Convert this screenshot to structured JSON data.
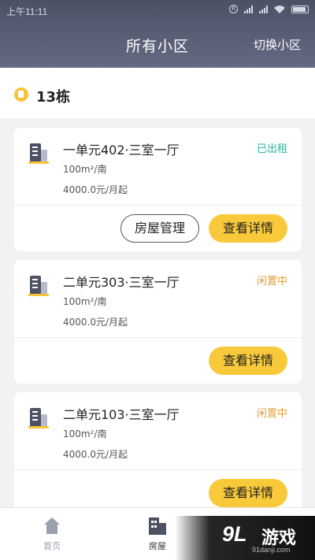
{
  "status_bar": {
    "time": "上午11:11",
    "icons": [
      "r-circle-icon",
      "signal-icon",
      "signal-icon",
      "wifi-icon",
      "battery-icon"
    ],
    "r_glyph": "R"
  },
  "header": {
    "title": "所有小区",
    "switch_label": "切换小区"
  },
  "building": {
    "name": "13栋",
    "icon": "building-badge-icon",
    "icon_color": "#f7c437"
  },
  "units": [
    {
      "title": "一单元402·三室一厅",
      "area": "100m²/南",
      "price": "4000.0元/月起",
      "status": "已出租",
      "status_color": "#2bb3a0",
      "manage_label": "房屋管理",
      "detail_label": "查看详情"
    },
    {
      "title": "二单元303·三室一厅",
      "area": "100m²/南",
      "price": "4000.0元/月起",
      "status": "闲置中",
      "status_color": "#e0a03a",
      "detail_label": "查看详情"
    },
    {
      "title": "二单元103·三室一厅",
      "area": "100m²/南",
      "price": "4000.0元/月起",
      "status": "闲置中",
      "status_color": "#e0a03a",
      "detail_label": "查看详情"
    }
  ],
  "tabbar": {
    "tabs": [
      {
        "label": "首页",
        "icon": "home-icon",
        "active": false,
        "color": "#9aa0ad"
      },
      {
        "label": "房屋",
        "icon": "house-icon",
        "active": true,
        "color": "#333333"
      }
    ]
  },
  "watermark": {
    "logo": "9L",
    "name": "游戏",
    "url": "91danji.com"
  },
  "colors": {
    "header_start": "#4b5165",
    "header_end": "#646a82",
    "accent": "#f8c93a",
    "rented": "#2bb3a0",
    "idle": "#e0a03a"
  }
}
